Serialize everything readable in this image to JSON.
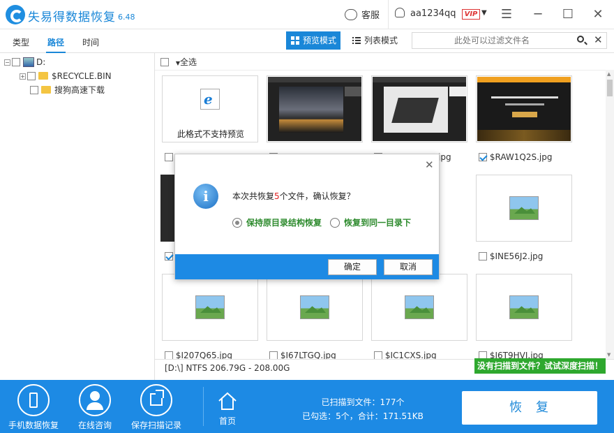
{
  "app": {
    "name": "失易得数据恢复",
    "version": "6.48"
  },
  "header": {
    "service_label": "客服",
    "username": "aa1234qq",
    "vip_label": "VIP"
  },
  "tabs": [
    {
      "label": "类型"
    },
    {
      "label": "路径"
    },
    {
      "label": "时间"
    }
  ],
  "tree": {
    "drive": "D:",
    "items": [
      {
        "label": "$RECYCLE.BIN"
      },
      {
        "label": "搜狗高速下载"
      }
    ]
  },
  "toolbar": {
    "preview_mode": "预览模式",
    "list_mode": "列表模式",
    "filter_placeholder": "此处可以过滤文件名"
  },
  "select_all": "全选",
  "files": [
    {
      "label": "此格式不支持预览",
      "kind": "unsupported"
    },
    {
      "label": "",
      "kind": "screenshot-dark"
    },
    {
      "label": "",
      "kind": "screenshot-laptop"
    },
    {
      "label": "$RAW1Q2S.jpg",
      "checked": true,
      "kind": "screenshot-promo"
    },
    {
      "label": "",
      "kind": "partial"
    },
    {
      "label": "$INE56J2.jpg",
      "kind": "image"
    },
    {
      "label": "$I207Q65.jpg",
      "kind": "image"
    },
    {
      "label": "$I67LTGQ.jpg",
      "kind": "image"
    },
    {
      "label": "$IC1CXS.jpg",
      "kind": "image"
    },
    {
      "label": "$I6T9HVI.jpg",
      "kind": "image"
    }
  ],
  "partial_labels": {
    "row1_col2": "jpg"
  },
  "path_info": "[D:\\] NTFS 206.79G - 208.00G",
  "deep_scan": "没有扫描到文件？试试深度扫描！",
  "bottom_nav": [
    {
      "label": "手机数据恢复",
      "icon": "phone-icon"
    },
    {
      "label": "在线咨询",
      "icon": "user-icon"
    },
    {
      "label": "保存扫描记录",
      "icon": "export-icon"
    },
    {
      "label": "首页",
      "icon": "home-icon"
    }
  ],
  "stats": {
    "scanned": "已扫描到文件：177个",
    "selected": "已勾选：5个，合计：171.51KB"
  },
  "recover_label": "恢复",
  "dialog": {
    "msg_prefix": "本次共恢复",
    "msg_count": "5",
    "msg_suffix": "个文件，确认恢复？",
    "option1": "保持原目录结构恢复",
    "option2": "恢复到同一目录下",
    "ok": "确定",
    "cancel": "取消"
  },
  "colors": {
    "accent": "#1d8ae4",
    "green": "#2ea82e",
    "vip": "#d33333"
  }
}
